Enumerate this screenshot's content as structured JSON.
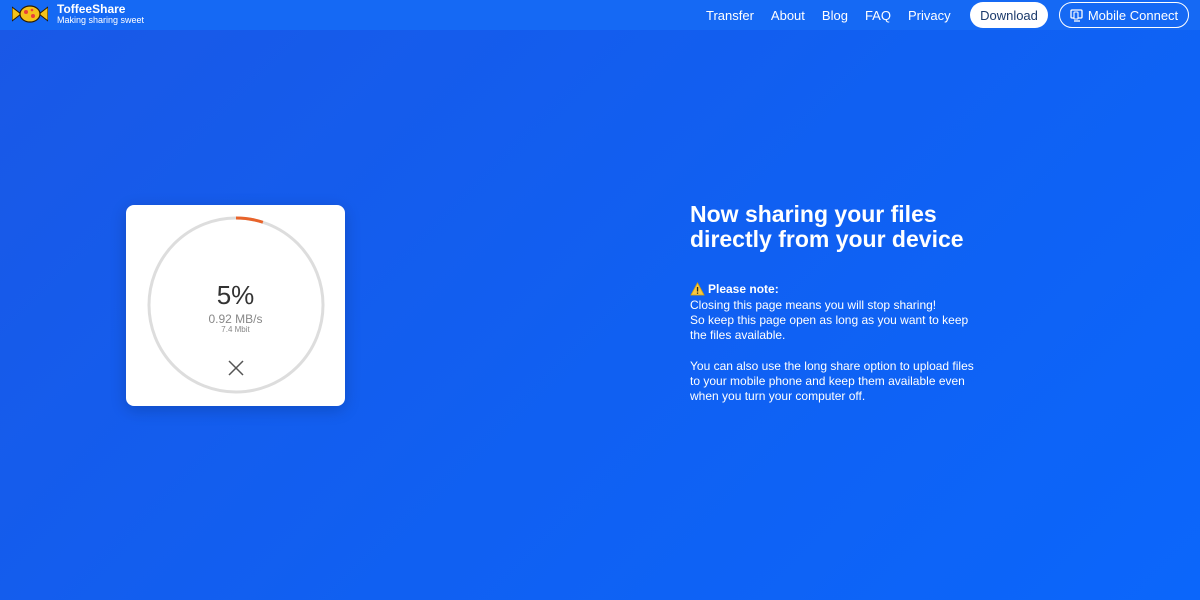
{
  "brand": {
    "name": "ToffeeShare",
    "tagline": "Making sharing sweet",
    "logo_icon": "candy-icon"
  },
  "nav": {
    "items": [
      "Transfer",
      "About",
      "Blog",
      "FAQ",
      "Privacy"
    ],
    "download_label": "Download",
    "mobile_connect_label": "Mobile Connect",
    "mobile_connect_icon": "monitor-phone-icon"
  },
  "transfer": {
    "progress_text": "5%",
    "progress_fraction": 0.05,
    "speed": "0.92 MB/s",
    "bitrate": "7.4 Mbit",
    "cancel_icon": "close-icon"
  },
  "info": {
    "headline_line1": "Now sharing your files",
    "headline_line2": "directly from your device",
    "note_icon": "warning-icon",
    "note_title": "Please note:",
    "note_lines": [
      "Closing this page means you will stop sharing!",
      "So keep this page open as long as you want to keep",
      "the files available."
    ],
    "extra_lines": [
      "You can also use the long share option to upload files",
      "to your mobile phone and keep them available even",
      "when you turn your computer off."
    ]
  },
  "colors": {
    "background": "#1060f2",
    "progress_arc": "#e8632a",
    "ring_track": "#dddddd"
  }
}
